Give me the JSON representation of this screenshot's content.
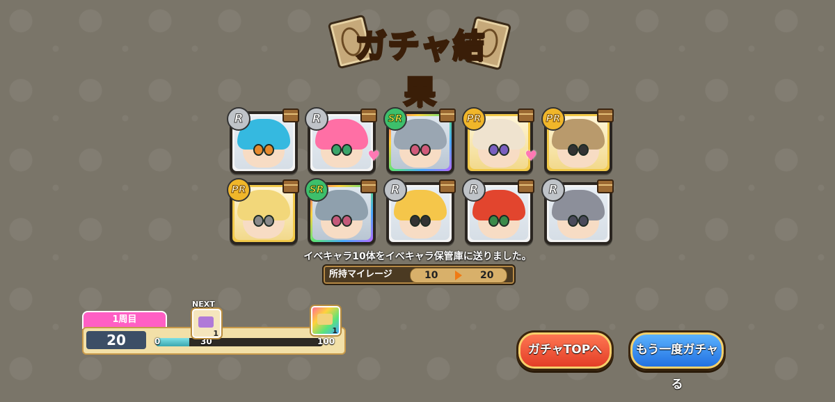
{
  "title": "ガチャ結果",
  "results": [
    {
      "rarity": "R",
      "hair": "#35b9e0",
      "eyes": "#e68a2e",
      "frame": "R",
      "heart": false
    },
    {
      "rarity": "R",
      "hair": "#ff6fa5",
      "eyes": "#3aa56a",
      "frame": "R",
      "heart": true
    },
    {
      "rarity": "SR",
      "hair": "#9aa6b2",
      "eyes": "#d05a7a",
      "frame": "SR",
      "heart": false
    },
    {
      "rarity": "PR",
      "hair": "#efe3cf",
      "eyes": "#7a5fc0",
      "frame": "PR",
      "heart": true
    },
    {
      "rarity": "PR",
      "hair": "#b99a6c",
      "eyes": "#333333",
      "frame": "PR",
      "heart": false
    },
    {
      "rarity": "PR",
      "hair": "#f2d77a",
      "eyes": "#8a8a8a",
      "frame": "PR",
      "heart": false
    },
    {
      "rarity": "SR",
      "hair": "#8fa0ad",
      "eyes": "#c45a7a",
      "frame": "SR",
      "heart": false
    },
    {
      "rarity": "R",
      "hair": "#f5c64a",
      "eyes": "#333333",
      "frame": "R",
      "heart": false
    },
    {
      "rarity": "R",
      "hair": "#e2452e",
      "eyes": "#3a8a4a",
      "frame": "R",
      "heart": false
    },
    {
      "rarity": "R",
      "hair": "#8c8f9a",
      "eyes": "#4a4a5a",
      "frame": "R",
      "heart": false
    }
  ],
  "message": "イベキャラ10体をイベキャラ保管庫に送りました。",
  "mileage": {
    "label": "所持マイレージ",
    "before": "10",
    "after": "20"
  },
  "progress": {
    "lap": "1周目",
    "count": "20",
    "progress_fraction": 0.2,
    "ticks": [
      "0",
      "30",
      "100"
    ],
    "next_label": "NEXT",
    "reward_next_qty": "1",
    "reward_end_qty": "1"
  },
  "buttons": {
    "top": "ガチャTOPへ",
    "again": "もう一度ガチャる"
  },
  "colors": {
    "background": "#7a7569",
    "accent_pink": "#ff5fc4",
    "button_red": "#e23a24",
    "button_blue": "#1e6de0"
  }
}
